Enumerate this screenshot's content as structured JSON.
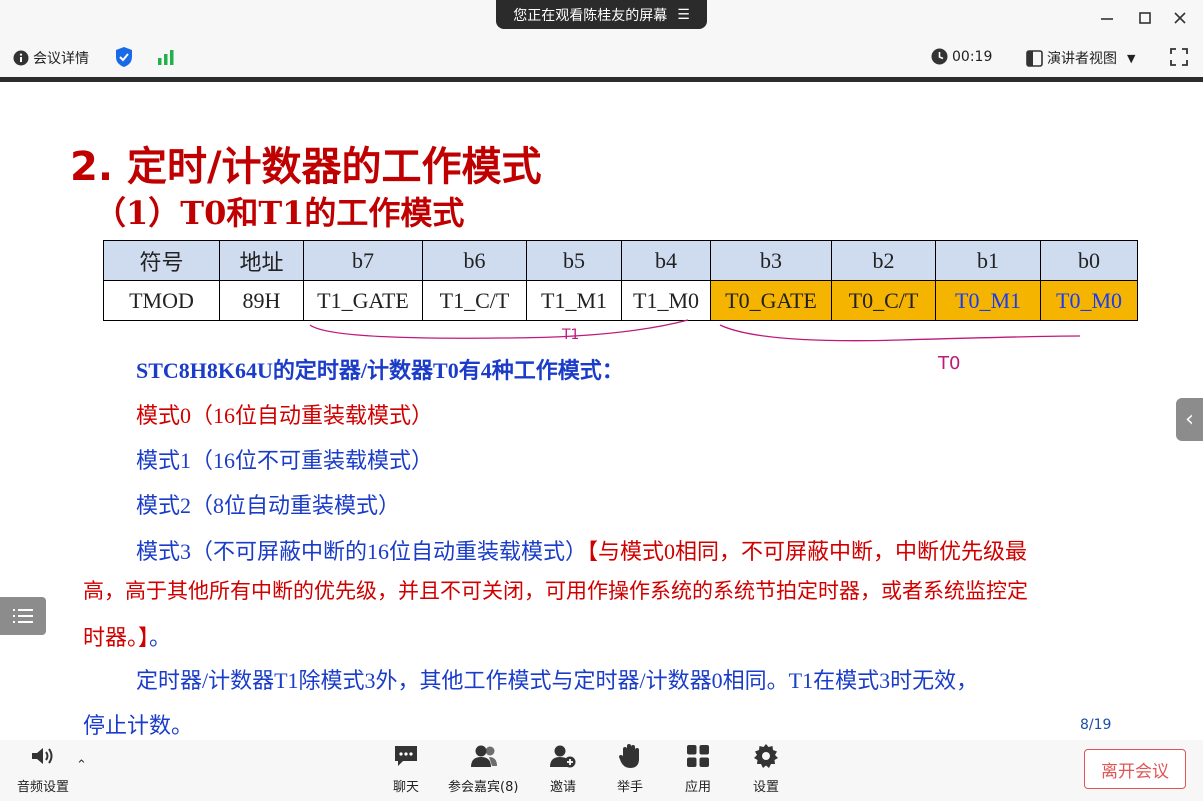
{
  "window": {
    "banner_text": "您正在观看陈桂友的屏幕",
    "banner_icon": "list-icon"
  },
  "info": {
    "details_label": "会议详情",
    "timer": "00:19",
    "view_label": "演讲者视图"
  },
  "slide": {
    "title": "2. 定时/计数器的工作模式",
    "subtitle": "（1）T0和T1的工作模式",
    "table": {
      "header": [
        "符号",
        "地址",
        "b7",
        "b6",
        "b5",
        "b4",
        "b3",
        "b2",
        "b1",
        "b0"
      ],
      "row": [
        "TMOD",
        "89H",
        "T1_GATE",
        "T1_C/T",
        "T1_M1",
        "T1_M0",
        "T0_GATE",
        "T0_C/T",
        "T0_M1",
        "T0_M0"
      ]
    },
    "line1": "STC8H8K64U的定时器/计数器T0有4种工作模式：",
    "mode0": "模式0（16位自动重装载模式）",
    "mode1": "模式1（16位不可重装载模式）",
    "mode2": "模式2（8位自动重装模式）",
    "mode3_a": "模式3（不可屏蔽中断的16位自动重装载模式）",
    "mode3_b": "【与模式0相同，不可屏蔽中断，中断优先级最",
    "mode3_c": "高，高于其他所有中断的优先级，并且不可关闭，可用作操作系统的系统节拍定时器，或者系统监控定",
    "mode3_d": "时器。】",
    "mode3_e": "。",
    "t1_a": "定时器/计数器T1除模式3外，其他工作模式与定时器/计数器0相同。T1在模式3时无效，",
    "t1_b": "停止计数。",
    "hand_t1": "T1",
    "hand_t0": "T0",
    "page": "8/19"
  },
  "toolbar": {
    "audio": "音频设置",
    "chat": "聊天",
    "participants": "参会嘉宾(8)",
    "invite": "邀请",
    "raise_hand": "举手",
    "apps": "应用",
    "settings": "设置",
    "leave": "离开会议"
  },
  "colors": {
    "title_red": "#c00000",
    "text_blue": "#1a3cc8",
    "highlight": "#f5b400",
    "header_bg": "#cfdcf0"
  }
}
